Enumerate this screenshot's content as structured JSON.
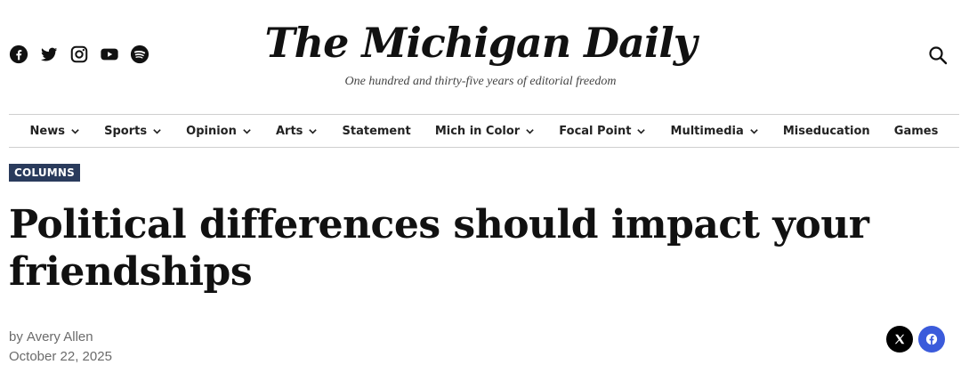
{
  "header": {
    "logo_text": "The Michigan Daily",
    "tagline": "One hundred and thirty-five years of editorial freedom",
    "social_icons": [
      "facebook-icon",
      "twitter-icon",
      "instagram-icon",
      "youtube-icon",
      "spotify-icon"
    ],
    "search_icon": "search-icon"
  },
  "nav": {
    "items": [
      {
        "label": "News",
        "has_dropdown": true
      },
      {
        "label": "Sports",
        "has_dropdown": true
      },
      {
        "label": "Opinion",
        "has_dropdown": true
      },
      {
        "label": "Arts",
        "has_dropdown": true
      },
      {
        "label": "Statement",
        "has_dropdown": false
      },
      {
        "label": "Mich in Color",
        "has_dropdown": true
      },
      {
        "label": "Focal Point",
        "has_dropdown": true
      },
      {
        "label": "Multimedia",
        "has_dropdown": true
      },
      {
        "label": "Miseducation",
        "has_dropdown": false
      },
      {
        "label": "Games",
        "has_dropdown": false
      }
    ]
  },
  "article": {
    "section": "COLUMNS",
    "title": "Political differences should impact your friendships",
    "byline_prefix": "by",
    "author": "Avery Allen",
    "date": "October 22, 2025"
  },
  "share": {
    "buttons": [
      "x-icon",
      "facebook-icon"
    ]
  },
  "colors": {
    "badge_bg": "#2a3b5c",
    "facebook_blue": "#3b5bdb",
    "x_black": "#000000"
  }
}
